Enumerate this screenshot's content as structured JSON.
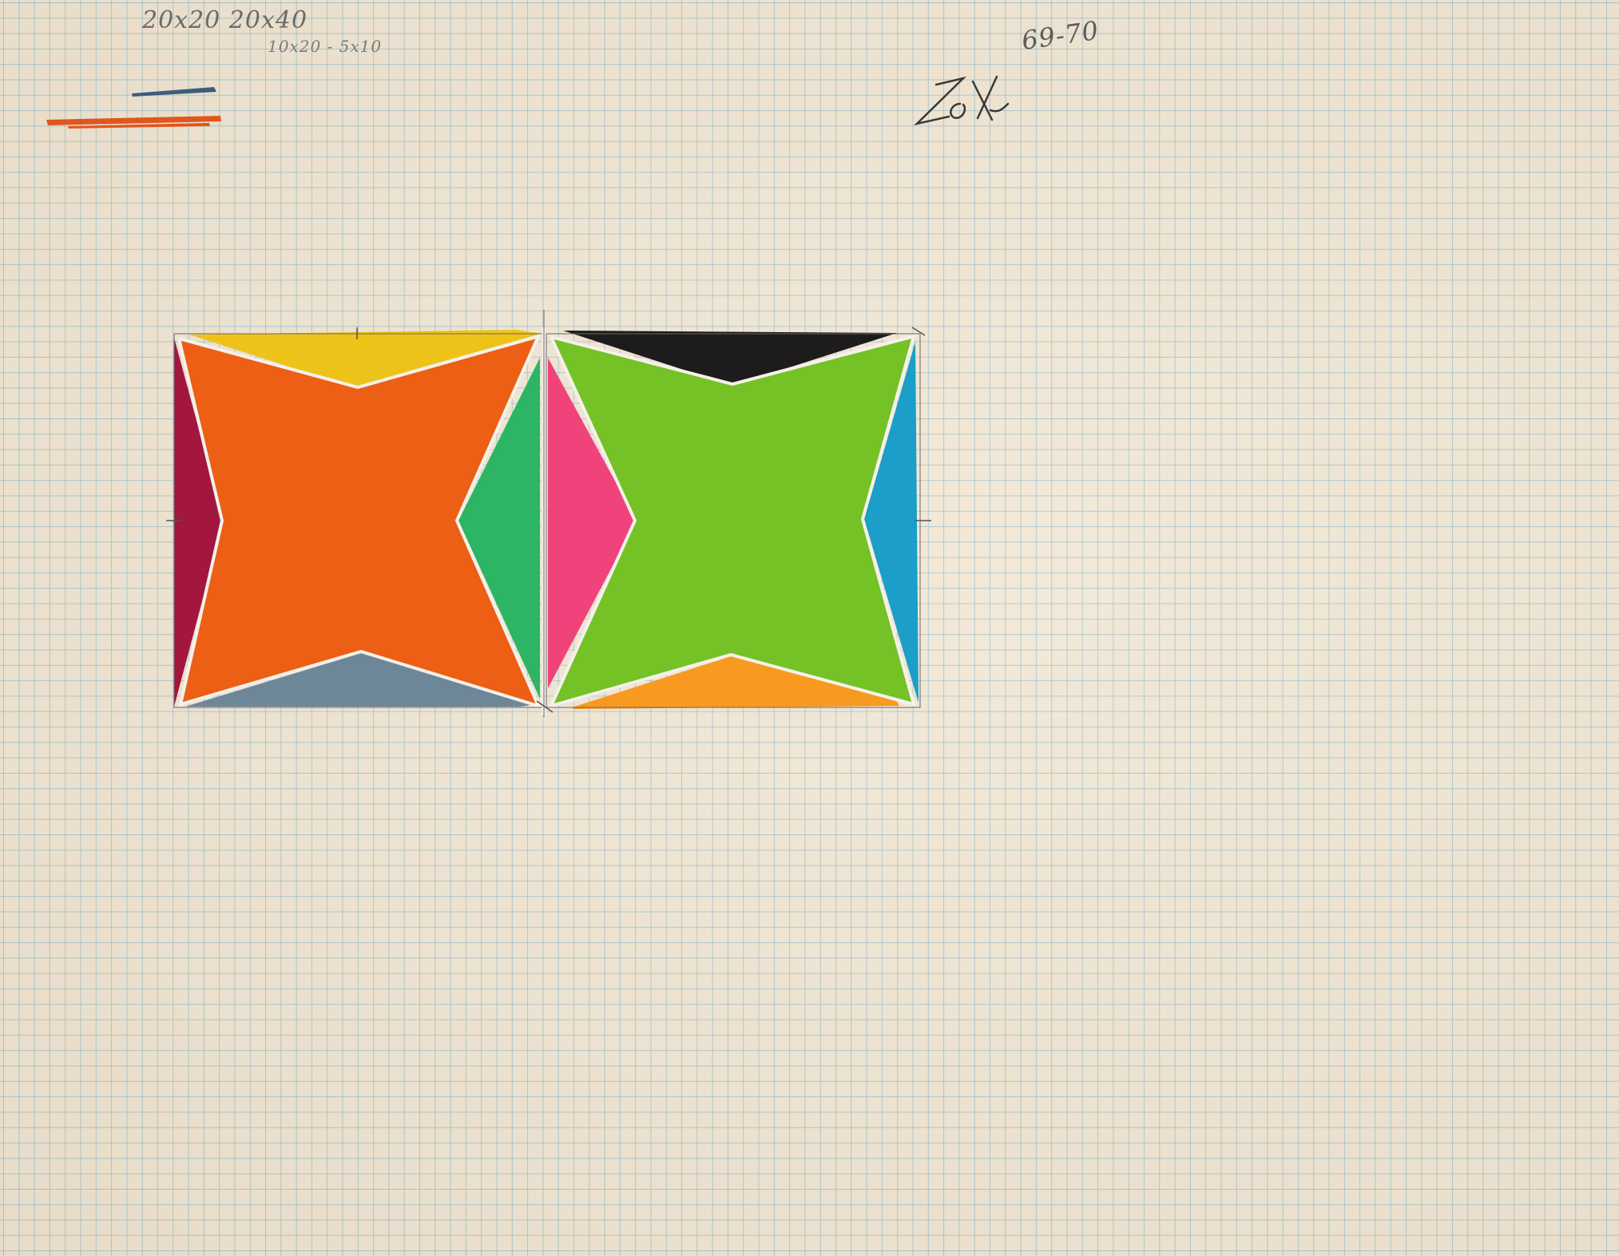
{
  "notes": {
    "dimensions_primary": "20x20 20x40",
    "dimensions_secondary": "10x20 - 5x10",
    "date": "69-70",
    "signature": "Zox"
  },
  "swatches": {
    "blue": "#3e5d7a",
    "orange": "#e0561e"
  },
  "colors": {
    "paper": "#f1e7d5",
    "grid": "#8fbfd6",
    "left_star_orange": "#ec5f14",
    "left_top_yellow": "#edc31a",
    "left_side_crimson": "#a3173f",
    "left_bottom_slate": "#6e8798",
    "center_emerald": "#2bb565",
    "center_pink": "#f0437c",
    "right_star_lime": "#74c226",
    "right_top_black": "#1d1b1c",
    "right_side_cyan": "#1b9ec7",
    "right_bottom_orange": "#f89a1f"
  }
}
